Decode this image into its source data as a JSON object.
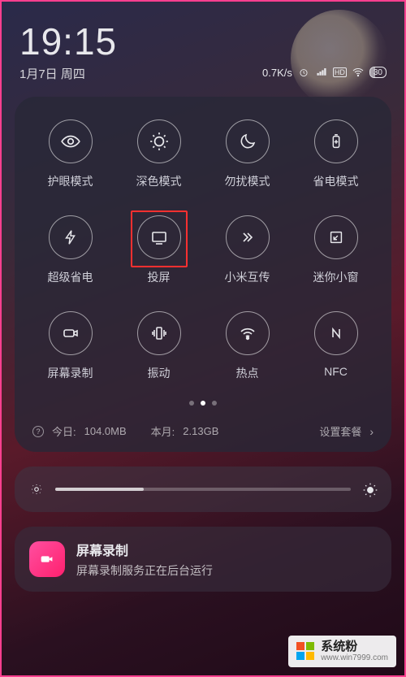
{
  "status": {
    "time": "19:15",
    "date": "1月7日 周四",
    "net_speed": "0.7K/s",
    "battery": "30",
    "hd_label": "HD"
  },
  "tiles": [
    {
      "key": "eye",
      "label": "护眼模式"
    },
    {
      "key": "dark",
      "label": "深色模式"
    },
    {
      "key": "dnd",
      "label": "勿扰模式"
    },
    {
      "key": "battery",
      "label": "省电模式"
    },
    {
      "key": "super",
      "label": "超级省电"
    },
    {
      "key": "cast",
      "label": "投屏",
      "highlight": true
    },
    {
      "key": "mishare",
      "label": "小米互传"
    },
    {
      "key": "mini",
      "label": "迷你小窗"
    },
    {
      "key": "record",
      "label": "屏幕录制"
    },
    {
      "key": "vibrate",
      "label": "振动"
    },
    {
      "key": "hotspot",
      "label": "热点"
    },
    {
      "key": "nfc",
      "label": "NFC"
    }
  ],
  "usage": {
    "today_label": "今日:",
    "today_value": "104.0MB",
    "month_label": "本月:",
    "month_value": "2.13GB",
    "settings_label": "设置套餐"
  },
  "notification": {
    "title": "屏幕录制",
    "body": "屏幕录制服务正在后台运行"
  },
  "watermark": {
    "brand": "系统粉",
    "url": "www.win7999.com"
  },
  "page_dots": {
    "count": 3,
    "active": 1
  }
}
